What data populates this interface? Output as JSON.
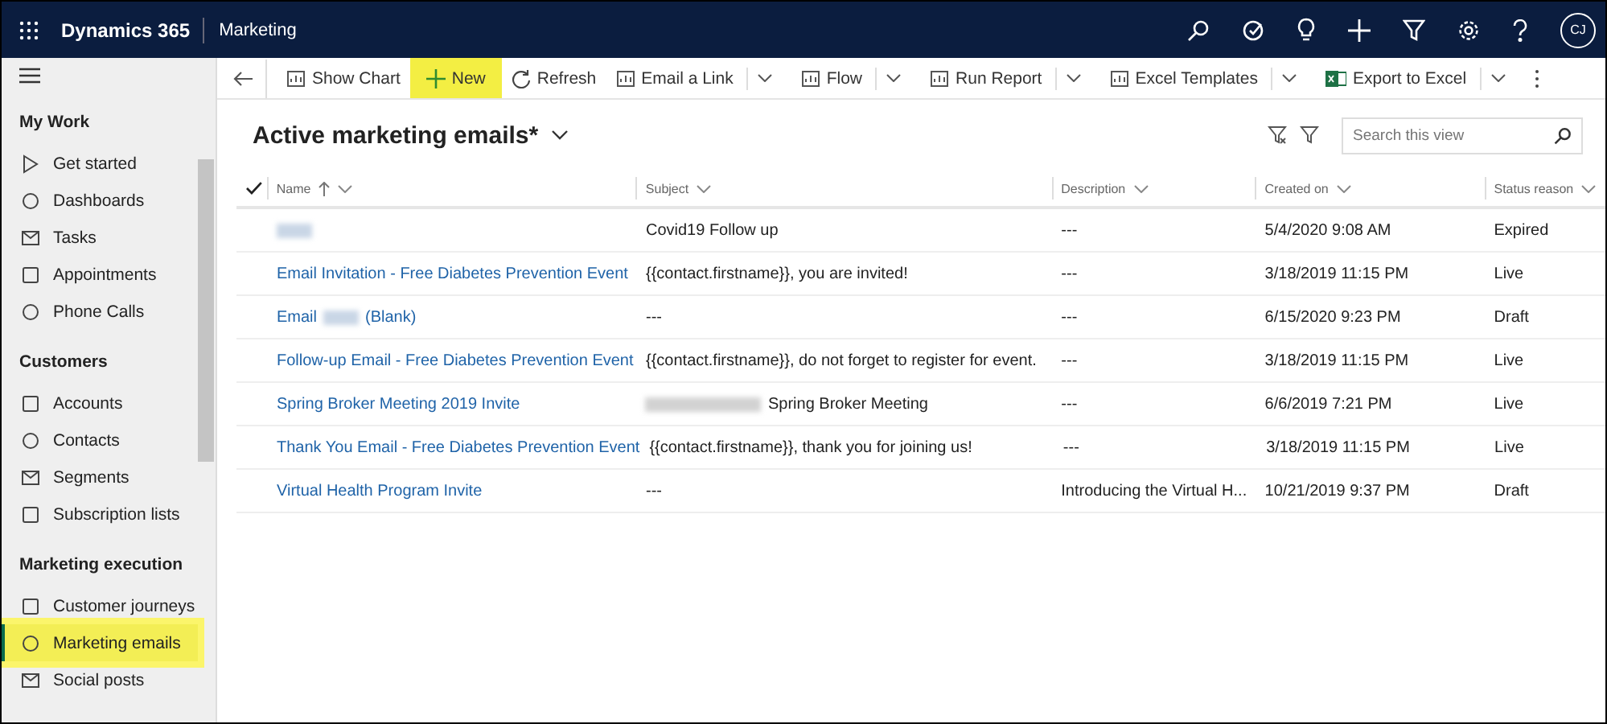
{
  "top_bar": {
    "app_name": "Dynamics 365",
    "module": "Marketing",
    "avatar_initials": "CJ"
  },
  "sidebar": {
    "sections": [
      {
        "title": "My Work",
        "items": [
          {
            "label": "Get started",
            "selected": false,
            "highlighted": false
          },
          {
            "label": "Dashboards",
            "selected": false,
            "highlighted": false
          },
          {
            "label": "Tasks",
            "selected": false,
            "highlighted": false
          },
          {
            "label": "Appointments",
            "selected": false,
            "highlighted": false
          },
          {
            "label": "Phone Calls",
            "selected": false,
            "highlighted": false
          }
        ]
      },
      {
        "title": "Customers",
        "items": [
          {
            "label": "Accounts",
            "selected": false,
            "highlighted": false
          },
          {
            "label": "Contacts",
            "selected": false,
            "highlighted": false
          },
          {
            "label": "Segments",
            "selected": false,
            "highlighted": false
          },
          {
            "label": "Subscription lists",
            "selected": false,
            "highlighted": false
          }
        ]
      },
      {
        "title": "Marketing execution",
        "items": [
          {
            "label": "Customer journeys",
            "selected": false,
            "highlighted": false
          },
          {
            "label": "Marketing emails",
            "selected": true,
            "highlighted": true
          },
          {
            "label": "Social posts",
            "selected": false,
            "highlighted": false
          }
        ]
      }
    ]
  },
  "command_bar": [
    {
      "label": "Show Chart",
      "dropdown": false,
      "highlighted": false
    },
    {
      "label": "New",
      "dropdown": false,
      "highlighted": true
    },
    {
      "label": "Refresh",
      "dropdown": false,
      "highlighted": false
    },
    {
      "label": "Email a Link",
      "dropdown": true,
      "highlighted": false
    },
    {
      "label": "Flow",
      "dropdown": true,
      "highlighted": false
    },
    {
      "label": "Run Report",
      "dropdown": true,
      "highlighted": false
    },
    {
      "label": "Excel Templates",
      "dropdown": true,
      "highlighted": false
    },
    {
      "label": "Export to Excel",
      "dropdown": true,
      "highlighted": false
    }
  ],
  "view": {
    "title": "Active marketing emails*",
    "search": {
      "placeholder": "Search this view"
    }
  },
  "table": {
    "columns": [
      {
        "label": "Name",
        "sorted": true
      },
      {
        "label": "Subject",
        "sorted": false
      },
      {
        "label": "Description",
        "sorted": false
      },
      {
        "label": "Created on",
        "sorted": false
      },
      {
        "label": "Status reason",
        "sorted": false
      }
    ],
    "rows": [
      {
        "name": [
          {
            "kind": "redacted"
          }
        ],
        "subject": [
          {
            "kind": "text",
            "text": "Covid19 Follow up"
          }
        ],
        "description": "---",
        "created_on": "5/4/2020 9:08 AM",
        "status": "Expired"
      },
      {
        "name": [
          {
            "kind": "text",
            "text": "Email Invitation - Free Diabetes Prevention Event"
          }
        ],
        "subject": [
          {
            "kind": "text",
            "text": "{{contact.firstname}}, you are invited!"
          }
        ],
        "description": "---",
        "created_on": "3/18/2019 11:15 PM",
        "status": "Live"
      },
      {
        "name": [
          {
            "kind": "text",
            "text": "Email"
          },
          {
            "kind": "redacted"
          },
          {
            "kind": "text",
            "text": "(Blank)"
          }
        ],
        "subject": [
          {
            "kind": "text",
            "text": "---"
          }
        ],
        "description": "---",
        "created_on": "6/15/2020 9:23 PM",
        "status": "Draft"
      },
      {
        "name": [
          {
            "kind": "text",
            "text": "Follow-up Email - Free Diabetes Prevention Event"
          }
        ],
        "subject": [
          {
            "kind": "text",
            "text": "{{contact.firstname}}, do not forget to register for event."
          }
        ],
        "description": "---",
        "created_on": "3/18/2019 11:15 PM",
        "status": "Live"
      },
      {
        "name": [
          {
            "kind": "text",
            "text": "Spring Broker Meeting 2019 Invite"
          }
        ],
        "subject": [
          {
            "kind": "redacted"
          },
          {
            "kind": "text",
            "text": "Spring Broker Meeting"
          }
        ],
        "description": "---",
        "created_on": "6/6/2019 7:21 PM",
        "status": "Live"
      },
      {
        "name": [
          {
            "kind": "text",
            "text": "Thank You Email - Free Diabetes Prevention Event"
          }
        ],
        "subject": [
          {
            "kind": "text",
            "text": "{{contact.firstname}}, thank you for joining us!"
          }
        ],
        "description": "---",
        "created_on": "3/18/2019 11:15 PM",
        "status": "Live"
      },
      {
        "name": [
          {
            "kind": "text",
            "text": "Virtual Health Program Invite"
          }
        ],
        "subject": [
          {
            "kind": "text",
            "text": "---"
          }
        ],
        "description": "Introducing the Virtual H...",
        "created_on": "10/21/2019 9:37 PM",
        "status": "Draft"
      }
    ]
  }
}
